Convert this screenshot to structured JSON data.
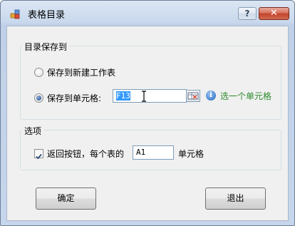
{
  "window": {
    "title": "表格目录",
    "help_label": "?",
    "close_label": "✕"
  },
  "group_save": {
    "label": "目录保存到",
    "option_new_sheet": "保存到新建工作表",
    "option_cell": "保存到单元格:",
    "selected_option": "option_cell",
    "cell_value": "F13",
    "hint": "选一个单元格"
  },
  "group_options": {
    "label": "选项",
    "back_button_label": "返回按钮，每个表的",
    "back_button_checked": true,
    "cell_value": "A1",
    "cell_suffix": "单元格"
  },
  "buttons": {
    "ok": "确定",
    "exit": "退出"
  },
  "colors": {
    "hint": "#2e8b2e",
    "close_button": "#c2432b",
    "selection": "#3399ff"
  }
}
